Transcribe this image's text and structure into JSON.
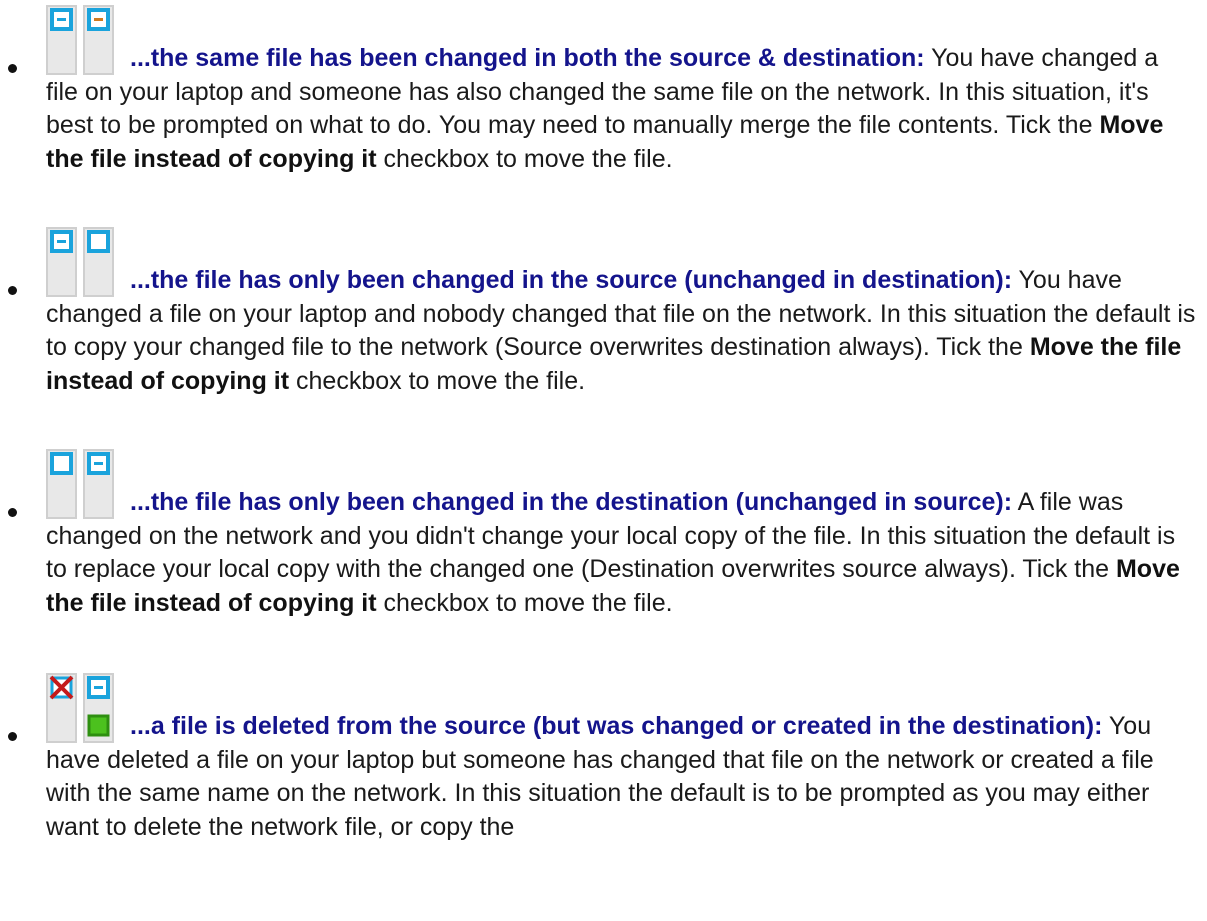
{
  "colors": {
    "heading": "#14148c",
    "body_text": "#1a1a1a",
    "icon_frame": "#cfcfcf",
    "icon_cyan": "#1aa3dc",
    "icon_orange": "#d07a1e",
    "icon_green": "#4cc11e",
    "icon_red": "#c41a1a"
  },
  "items": [
    {
      "icons": [
        "file-changed-source-icon",
        "file-changed-destination-icon"
      ],
      "heading": "...the same file has been changed in both the source & destination:",
      "body_before": "You have changed a file on your laptop and someone has also changed the same file on the network. In this situation, it's best to be prompted on what to do. You may need to manually merge the file contents. Tick the",
      "bold_phrase": "Move the file instead of copying it",
      "body_after": "checkbox to move the file."
    },
    {
      "icons": [
        "file-changed-source-icon",
        "file-unchanged-destination-icon"
      ],
      "heading": "...the file has only been changed in the source (unchanged in destination):",
      "body_before": "You have changed a file on your laptop and nobody changed that file on the network. In this situation the default is to copy your changed file to the network (Source overwrites destination always). Tick the",
      "bold_phrase": "Move the file instead of copying it",
      "body_after": "checkbox to move the file."
    },
    {
      "icons": [
        "file-unchanged-source-icon",
        "file-changed-destination-icon"
      ],
      "heading": "...the file has only been changed in the destination (unchanged in source):",
      "body_before": "A file was changed on the network and you didn't change your local copy of the file. In this situation the default is to replace your local copy with the changed one (Destination overwrites source always). Tick the",
      "bold_phrase": "Move the file instead of copying it",
      "body_after": "checkbox to move the file."
    },
    {
      "icons": [
        "file-deleted-source-icon",
        "file-created-destination-icon"
      ],
      "heading": "...a file is deleted from the source (but was changed or created in the destination):",
      "body_before": "You have deleted a file on your laptop but someone has changed that file on the network or created a file with the same name on the network. In this situation the default is to be prompted as you may either want to delete the network file, or copy the",
      "bold_phrase": "",
      "body_after": ""
    }
  ]
}
